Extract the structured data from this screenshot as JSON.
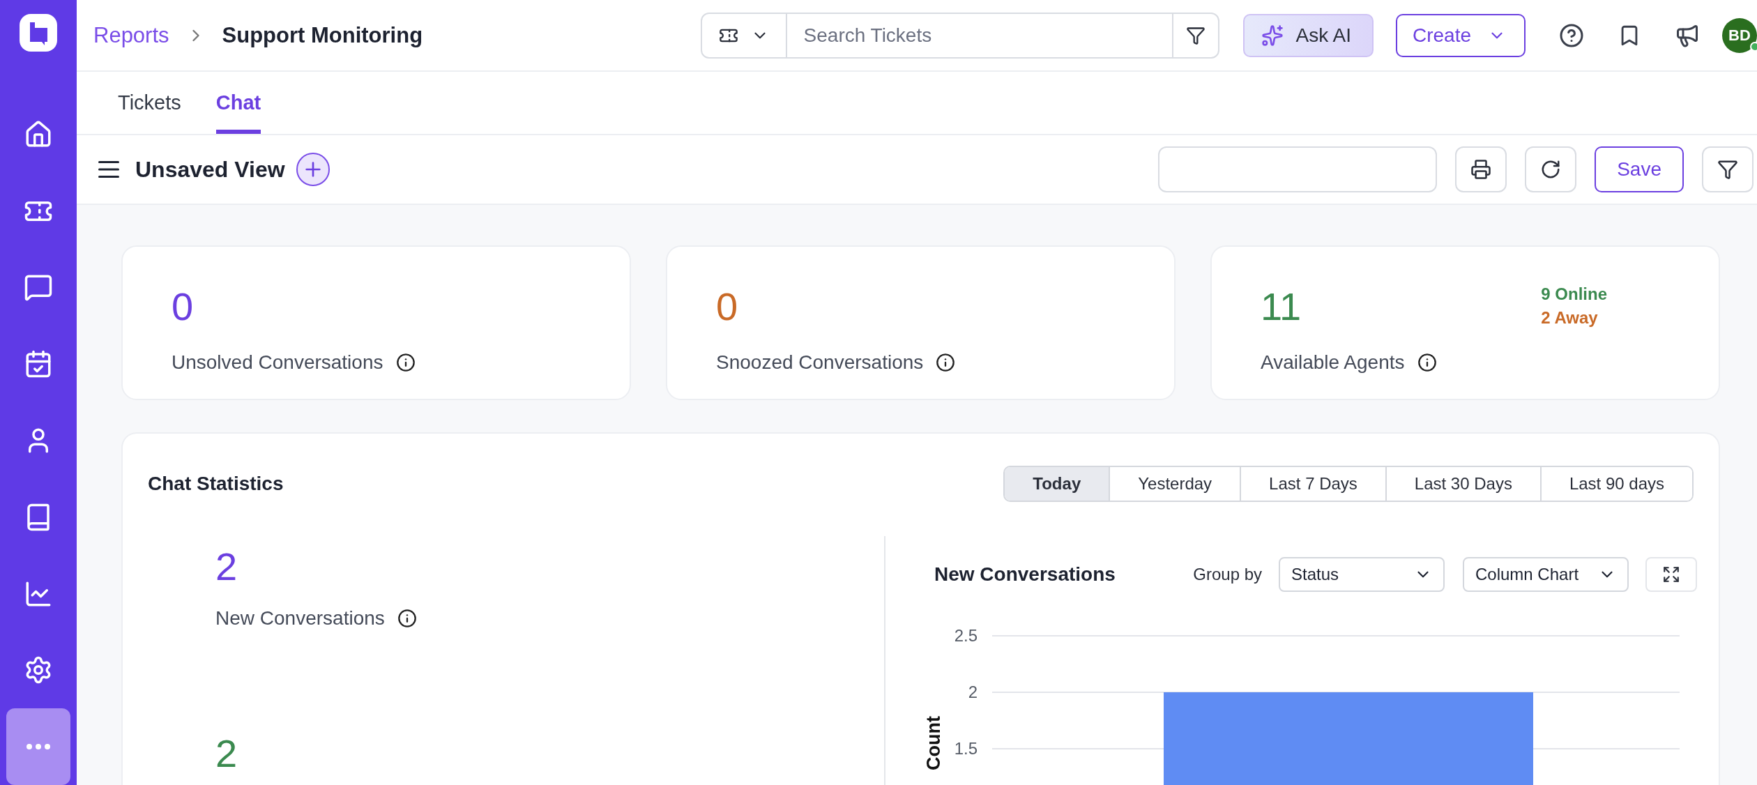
{
  "sidebar": {
    "items": [
      {
        "selected": false
      },
      {
        "selected": false
      },
      {
        "selected": false
      },
      {
        "selected": false
      },
      {
        "selected": false
      },
      {
        "selected": false
      },
      {
        "selected": false
      },
      {
        "selected": false
      },
      {
        "selected": true
      }
    ]
  },
  "header": {
    "breadcrumb": [
      "Reports",
      "Support Monitoring"
    ],
    "search": {
      "placeholder": "Search Tickets"
    },
    "ask_ai": "Ask AI",
    "create": "Create",
    "avatar": {
      "initials": "BD",
      "online": true
    }
  },
  "tabs": [
    {
      "label": "Tickets",
      "selected": false
    },
    {
      "label": "Chat",
      "selected": true
    }
  ],
  "view": {
    "title": "Unsaved View",
    "save": "Save"
  },
  "cards": [
    {
      "value": "0",
      "label": "Unsolved Conversations",
      "color": "#6b3fe0"
    },
    {
      "value": "0",
      "label": "Snoozed Conversations",
      "color": "#c96a27"
    },
    {
      "value": "11",
      "label": "Available Agents",
      "color": "#3b8a4f",
      "details": [
        {
          "text": "9 Online",
          "color": "#3b8a4f"
        },
        {
          "text": "2 Away",
          "color": "#c96a27"
        }
      ]
    }
  ],
  "chat_statistics": {
    "title": "Chat Statistics",
    "ranges": [
      {
        "label": "Today",
        "selected": true
      },
      {
        "label": "Yesterday",
        "selected": false
      },
      {
        "label": "Last 7 Days",
        "selected": false
      },
      {
        "label": "Last 30 Days",
        "selected": false
      },
      {
        "label": "Last 90 days",
        "selected": false
      }
    ],
    "metrics": [
      {
        "value": "2",
        "label": "New Conversations",
        "color": "#6b3fe0"
      },
      {
        "value": "2",
        "color": "#3b8a4f"
      }
    ],
    "chart_panel": {
      "title": "New Conversations",
      "group_by_label": "Group by",
      "group_by": "Status",
      "chart_type": "Column Chart",
      "chart_data": {
        "type": "bar",
        "ylabel": "Count",
        "ylim": [
          0,
          2.5
        ],
        "yticks": [
          1.5,
          2,
          2.5
        ],
        "series": [
          {
            "color": "#5f8cf3",
            "values": [
              2
            ]
          }
        ]
      }
    }
  }
}
